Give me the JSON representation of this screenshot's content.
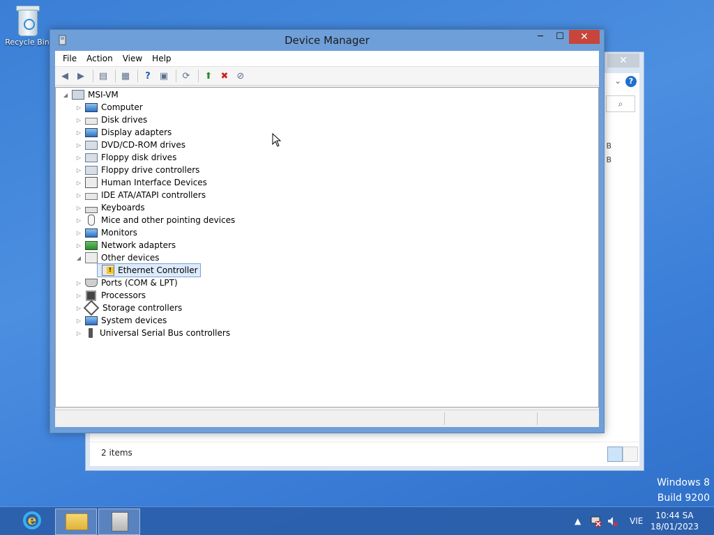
{
  "desktop": {
    "recycle_bin_label": "Recycle Bin",
    "watermark_line1": "Windows 8",
    "watermark_line2": "Build 9200"
  },
  "bg_window": {
    "close_glyph": "✕",
    "status_items": "2 items",
    "size_col_1": "B",
    "size_col_2": "B"
  },
  "device_manager": {
    "title": "Device Manager",
    "menu": [
      "File",
      "Action",
      "View",
      "Help"
    ],
    "root": "MSI-VM",
    "categories": [
      {
        "label": "Computer",
        "icon": "computer-icon"
      },
      {
        "label": "Disk drives",
        "icon": "disk-drive-icon"
      },
      {
        "label": "Display adapters",
        "icon": "display-adapter-icon"
      },
      {
        "label": "DVD/CD-ROM drives",
        "icon": "dvd-drive-icon"
      },
      {
        "label": "Floppy disk drives",
        "icon": "floppy-drive-icon"
      },
      {
        "label": "Floppy drive controllers",
        "icon": "floppy-controller-icon"
      },
      {
        "label": "Human Interface Devices",
        "icon": "hid-icon"
      },
      {
        "label": "IDE ATA/ATAPI controllers",
        "icon": "ide-controller-icon"
      },
      {
        "label": "Keyboards",
        "icon": "keyboard-icon"
      },
      {
        "label": "Mice and other pointing devices",
        "icon": "mouse-icon"
      },
      {
        "label": "Monitors",
        "icon": "monitor-icon"
      },
      {
        "label": "Network adapters",
        "icon": "network-adapter-icon"
      },
      {
        "label": "Other devices",
        "icon": "other-devices-icon"
      },
      {
        "label": "Ethernet Controller",
        "icon": "warning-device-icon"
      },
      {
        "label": "Ports (COM & LPT)",
        "icon": "ports-icon"
      },
      {
        "label": "Processors",
        "icon": "processor-icon"
      },
      {
        "label": "Storage controllers",
        "icon": "storage-controller-icon"
      },
      {
        "label": "System devices",
        "icon": "system-devices-icon"
      },
      {
        "label": "Universal Serial Bus controllers",
        "icon": "usb-icon"
      }
    ]
  },
  "taskbar": {
    "language": "VIE",
    "time": "10:44 SA",
    "date": "18/01/2023"
  }
}
